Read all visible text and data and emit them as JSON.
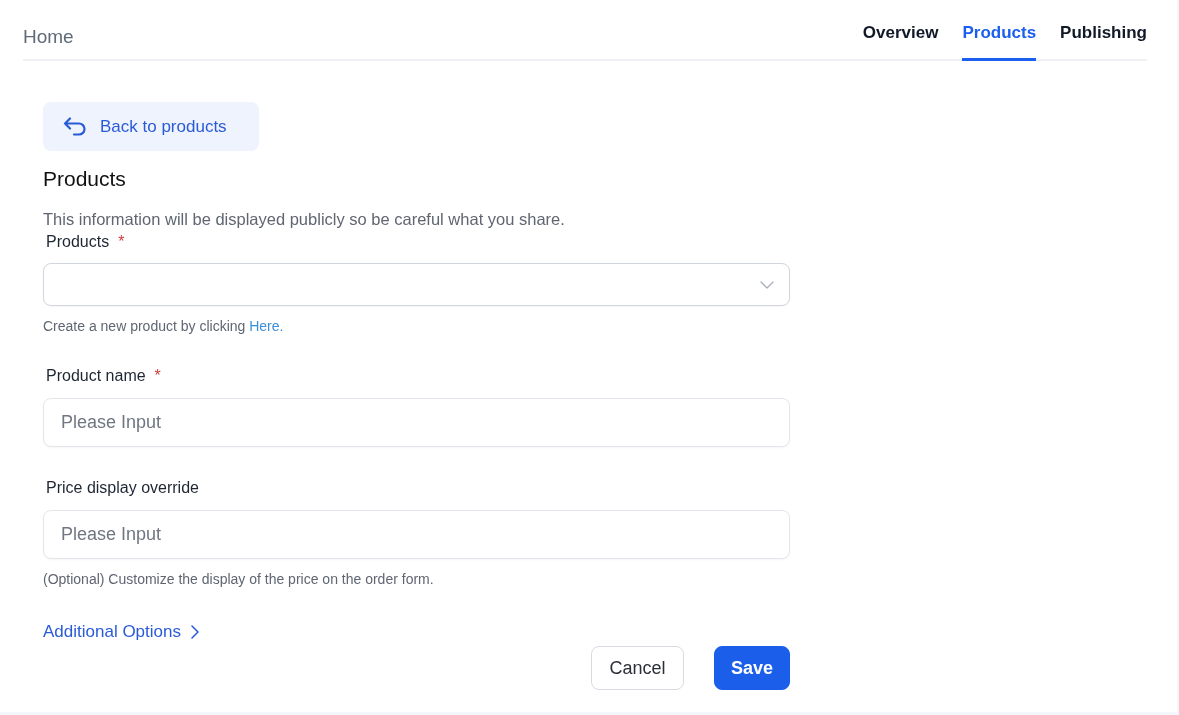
{
  "header": {
    "title": "Home",
    "tabs": [
      {
        "label": "Overview",
        "selected": false
      },
      {
        "label": "Products",
        "selected": true
      },
      {
        "label": "Publishing",
        "selected": false
      }
    ]
  },
  "back_button": {
    "label": "Back to products"
  },
  "section": {
    "title": "Products",
    "description": "This information will be displayed publicly so be careful what you share."
  },
  "fields": [
    {
      "kind": "select",
      "label": "Products",
      "required_mark": "*",
      "helper": {
        "text": "Create a new product by clicking",
        "link": "Here."
      }
    },
    {
      "kind": "input",
      "label": "Product name",
      "required_mark": "*",
      "placeholder": "Please Input"
    },
    {
      "kind": "input",
      "label": "Price display override",
      "placeholder": "Please Input",
      "helper": {
        "text": "(Optional) Customize the display of the price on the order form."
      }
    }
  ],
  "additional_options": {
    "label": "Additional Options"
  },
  "buttons": [
    {
      "kind": "secondary",
      "label": "Cancel"
    },
    {
      "kind": "primary",
      "label": "Save"
    }
  ]
}
